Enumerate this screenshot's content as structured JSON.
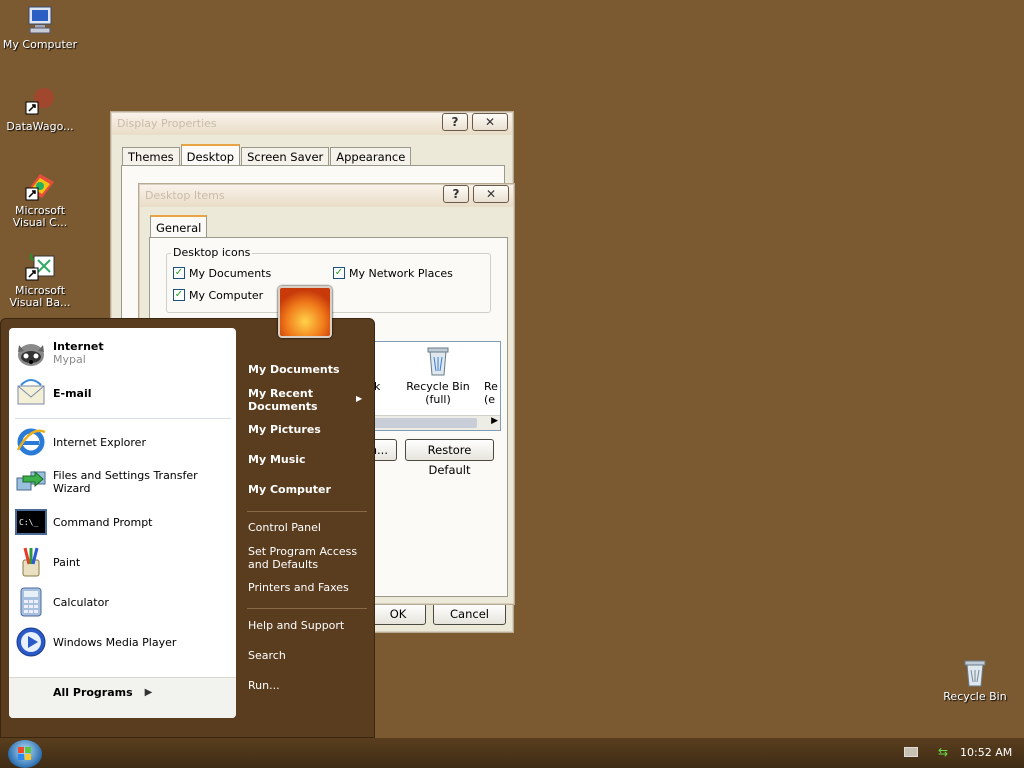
{
  "desktop": {
    "icons": [
      {
        "label": "My Computer"
      },
      {
        "label": "DataWago..."
      },
      {
        "label_line1": "Microsoft",
        "label_line2": "Visual C..."
      },
      {
        "label_line1": "Microsoft",
        "label_line2": "Visual Ba..."
      },
      {
        "label": "Recycle Bin"
      }
    ]
  },
  "display_properties": {
    "title": "Display Properties",
    "tabs": [
      "Themes",
      "Desktop",
      "Screen Saver",
      "Appearance"
    ],
    "ok_label": "OK",
    "cancel_label": "Cancel"
  },
  "desktop_items": {
    "title": "Desktop Items",
    "tab": "General",
    "group_label": "Desktop icons",
    "checkboxes": [
      {
        "label": "My Documents",
        "checked": true
      },
      {
        "label": "My Network Places",
        "checked": true
      },
      {
        "label": "My Computer",
        "checked": true
      }
    ],
    "icon_list": [
      {
        "label": "k"
      },
      {
        "label_line1": "Recycle Bin",
        "label_line2": "(full)"
      },
      {
        "label_line1": "Re",
        "label_line2": "(e"
      }
    ],
    "change_icon_label": "n...",
    "restore_default_label": "Restore Default"
  },
  "start_menu": {
    "pinned": [
      {
        "title": "Internet",
        "subtitle": "Mypal"
      },
      {
        "title": "E-mail"
      }
    ],
    "recent": [
      {
        "label": "Internet Explorer"
      },
      {
        "label": "Files and Settings Transfer Wizard"
      },
      {
        "label": "Command Prompt"
      },
      {
        "label": "Paint"
      },
      {
        "label": "Calculator"
      },
      {
        "label": "Windows Media Player"
      }
    ],
    "all_programs": "All Programs",
    "right": {
      "my_documents": "My Documents",
      "my_recent_1": "My Recent",
      "my_recent_2": "Documents",
      "my_pictures": "My Pictures",
      "my_music": "My Music",
      "my_computer": "My Computer",
      "control_panel": "Control Panel",
      "spad_1": "Set Program Access",
      "spad_2": "and Defaults",
      "printers": "Printers and Faxes",
      "help": "Help and Support",
      "search": "Search",
      "run": "Run..."
    }
  },
  "taskbar": {
    "clock": "10:52 AM"
  },
  "colors": {
    "desktop_bg": "#7b5a32",
    "start_menu_bg": "#5a3d1f",
    "accent_tab": "#e8a445"
  }
}
